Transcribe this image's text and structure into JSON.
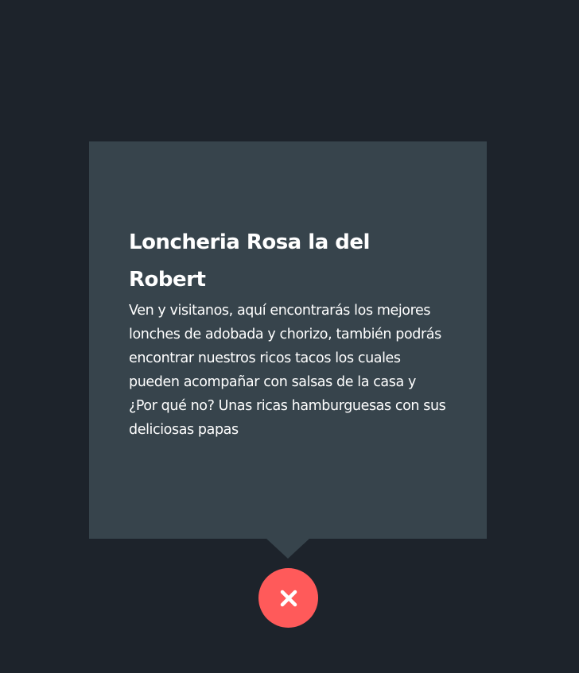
{
  "card": {
    "title": "Loncheria Rosa la del Robert",
    "description": "Ven y visitanos, aquí encontrarás los mejores lonches de adobada y chorizo, también podrás encontrar nuestros ricos tacos los cuales pueden acompañar con salsas de la casa y ¿Por qué no? Unas ricas hamburguesas con sus deliciosas papas"
  },
  "close_button": {
    "icon": "close-icon",
    "color": "#ff5a5a"
  },
  "colors": {
    "background": "#1d232b",
    "card": "#37444c",
    "text": "#ffffff",
    "accent": "#ff5a5a"
  }
}
